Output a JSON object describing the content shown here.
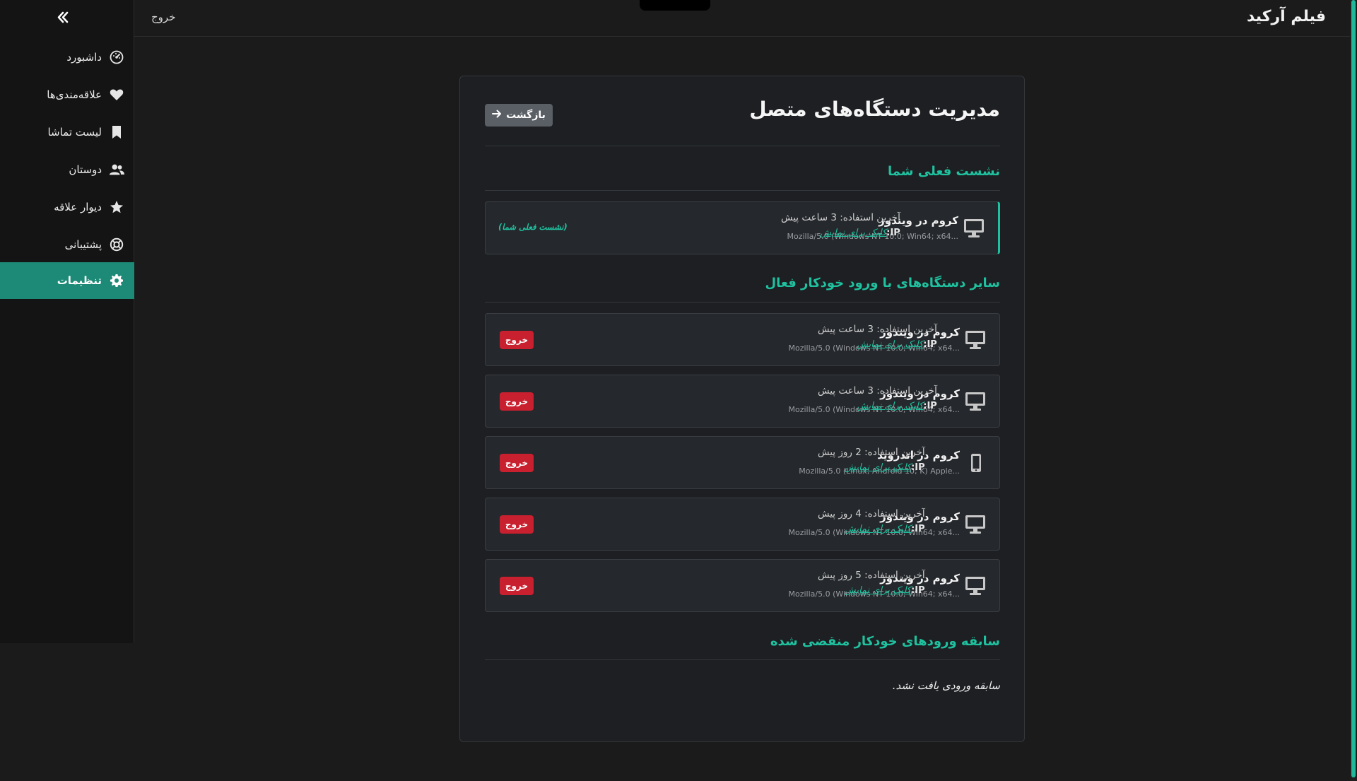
{
  "app": {
    "brand": "فیلم آرکید",
    "logout_label": "خروج"
  },
  "sidebar": {
    "items": [
      {
        "label": "داشبورد",
        "icon": "dashboard-icon",
        "active": false
      },
      {
        "label": "علاقه‌مندی‌ها",
        "icon": "heart-icon",
        "active": false
      },
      {
        "label": "لیست تماشا",
        "icon": "bookmark-icon",
        "active": false
      },
      {
        "label": "دوستان",
        "icon": "users-icon",
        "active": false
      },
      {
        "label": "دیوار علاقه",
        "icon": "star-icon",
        "active": false
      },
      {
        "label": "پشتیبانی",
        "icon": "lifebuoy-icon",
        "active": false
      },
      {
        "label": "تنظیمات",
        "icon": "gear-icon",
        "active": true
      }
    ]
  },
  "page": {
    "title": "مدیریت دستگاه‌های متصل",
    "back_label": "بازگشت",
    "current_section_title": "نشست فعلی شما",
    "other_section_title": "سایر دستگاه‌های با ورود خودکار فعال",
    "expired_section_title": "سابقه ورودهای خودکار منقضی شده",
    "expired_empty": "سابقه ورودی یافت نشد."
  },
  "ip_label": "IP:",
  "ip_link": "کلیک برای نمایش",
  "logout_button": "خروج",
  "current_session": {
    "name": "کروم در ویندوز",
    "ua": "Mozilla/5.0 (Windows NT 10.0; Win64; x64...",
    "last_used": "آخرین استفاده: 3 ساعت پیش",
    "tag": "(نشست فعلی شما)",
    "device": "desktop"
  },
  "other_devices": [
    {
      "name": "کروم در ویندوز",
      "ua": "Mozilla/5.0 (Windows NT 10.0; Win64; x64...",
      "last_used": "آخرین استفاده: 3 ساعت پیش",
      "device": "desktop"
    },
    {
      "name": "کروم در ویندوز",
      "ua": "Mozilla/5.0 (Windows NT 10.0; Win64; x64...",
      "last_used": "آخرین استفاده: 3 ساعت پیش",
      "device": "desktop"
    },
    {
      "name": "کروم در اندروید",
      "ua": "Mozilla/5.0 (Linux; Android 10; K) Apple...",
      "last_used": "آخرین استفاده: 2 روز پیش",
      "device": "mobile"
    },
    {
      "name": "کروم در ویندوز",
      "ua": "Mozilla/5.0 (Windows NT 10.0; Win64; x64...",
      "last_used": "آخرین استفاده: 4 روز پیش",
      "device": "desktop"
    },
    {
      "name": "کروم در ویندوز",
      "ua": "Mozilla/5.0 (Windows NT 10.0; Win64; x64...",
      "last_used": "آخرین استفاده: 5 روز پیش",
      "device": "desktop"
    }
  ],
  "colors": {
    "accent": "#1fc2a0",
    "active_nav": "#1c8a76",
    "danger": "#c9202f"
  }
}
